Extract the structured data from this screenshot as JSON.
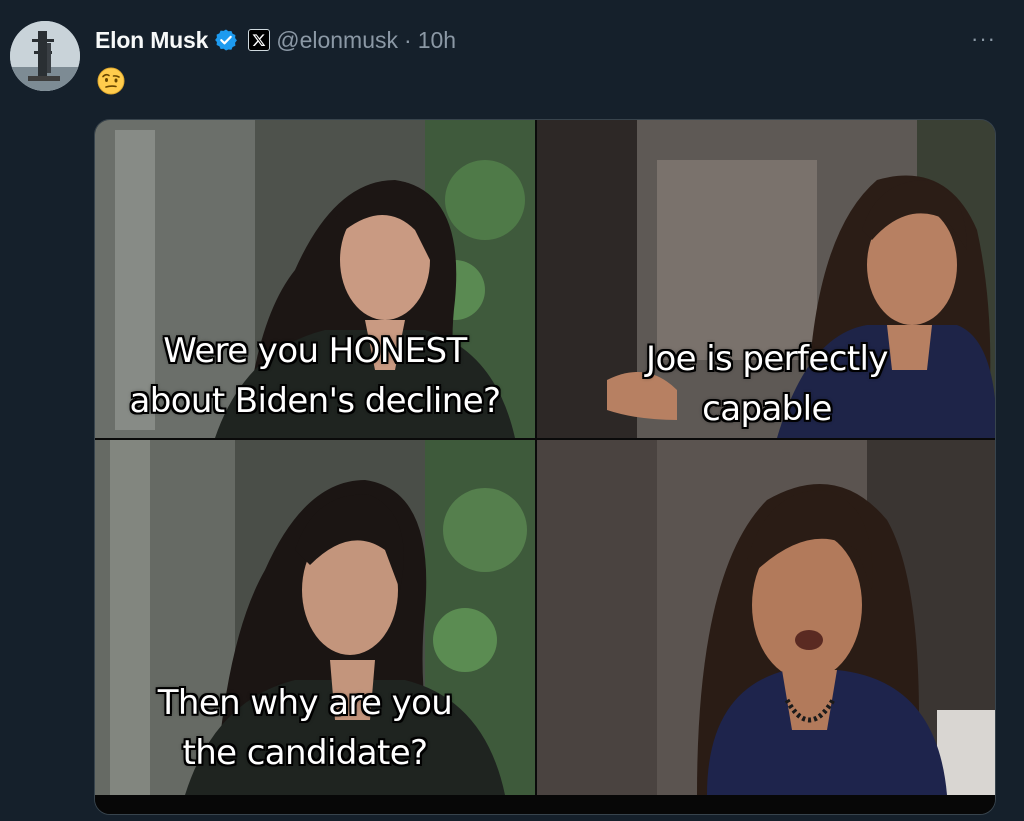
{
  "tweet": {
    "author_name": "Elon Musk",
    "handle": "@elonmusk",
    "separator": "·",
    "time": "10h",
    "more_label": "···",
    "body_emoji": "🤨",
    "icons": {
      "verified": "verified-badge-icon",
      "affiliate": "x-logo-icon",
      "more": "more-icon",
      "avatar": "avatar-image"
    },
    "colors": {
      "background": "#15202b",
      "verified_blue": "#1d9bf0",
      "secondary_text": "#8b98a5"
    }
  },
  "media": {
    "panels": [
      {
        "caption_lines": [
          "Were you HONEST",
          "about Biden's decline?"
        ]
      },
      {
        "caption_lines": [
          "Joe is perfectly",
          "capable"
        ]
      },
      {
        "caption_lines": [
          "Then why are you",
          "the candidate?"
        ]
      },
      {
        "caption_lines": []
      }
    ]
  }
}
